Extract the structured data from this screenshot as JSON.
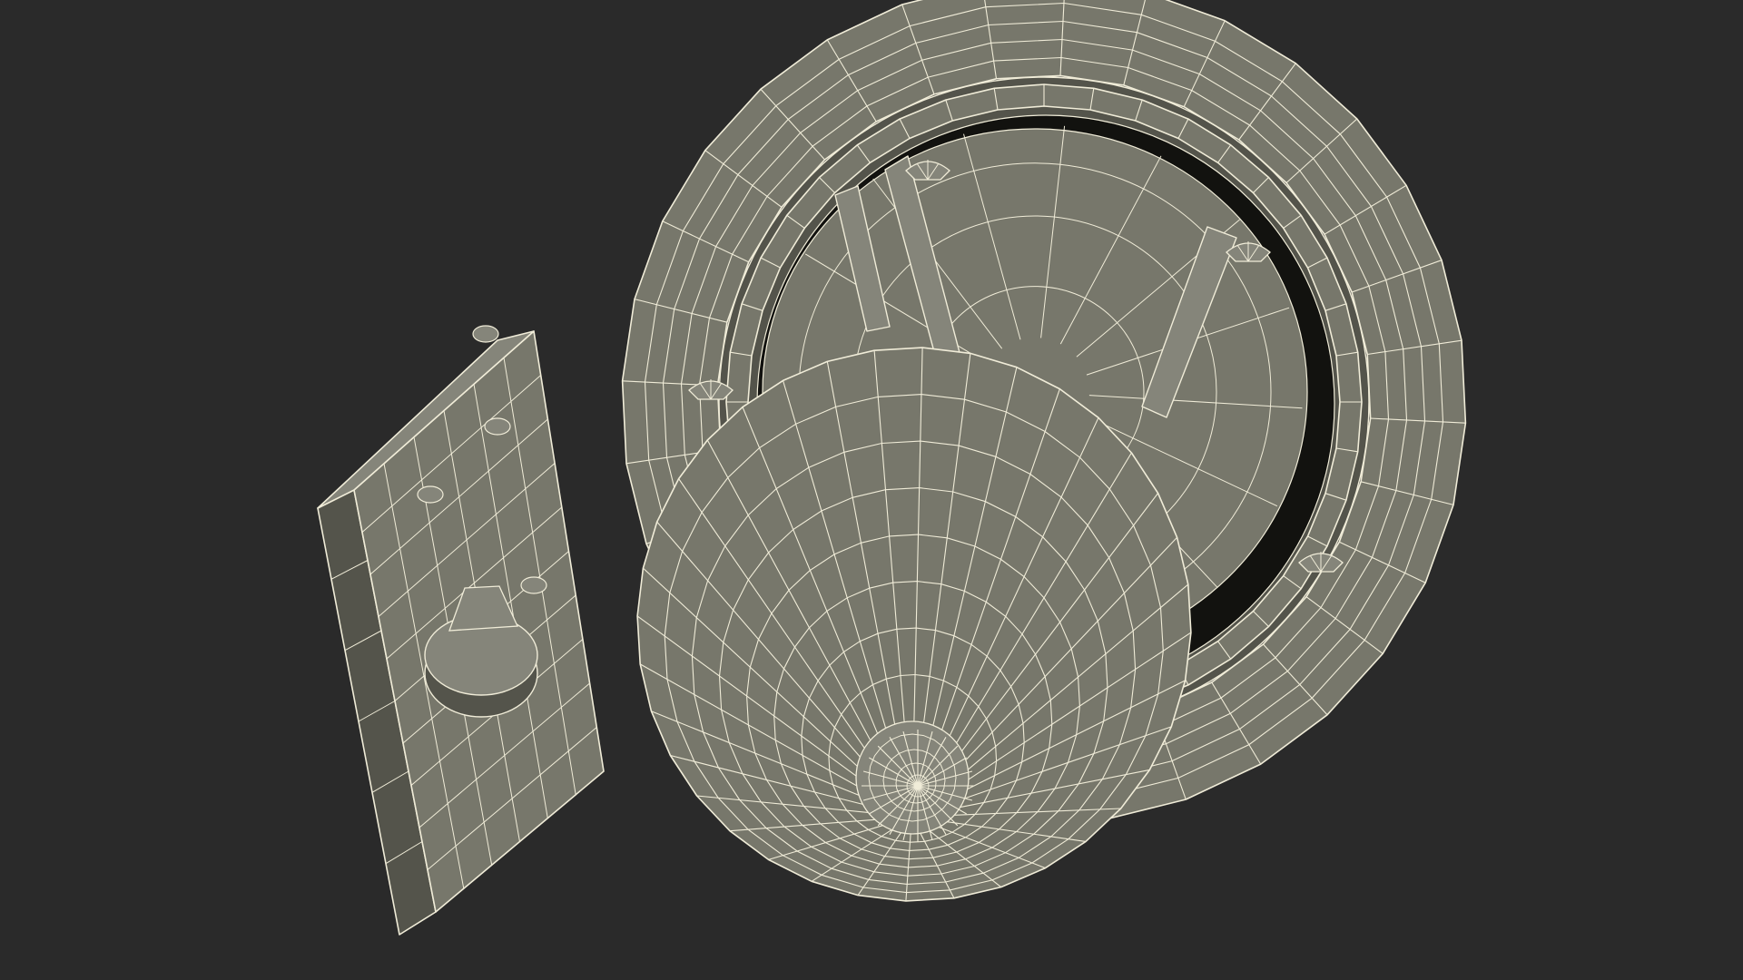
{
  "scene": {
    "background": "#2a2a2a",
    "surface": "#77776b",
    "surface_dark": "#54544b",
    "surface_light": "#85857a",
    "cavity": "#12120f",
    "wire": "#f0ecd8"
  }
}
